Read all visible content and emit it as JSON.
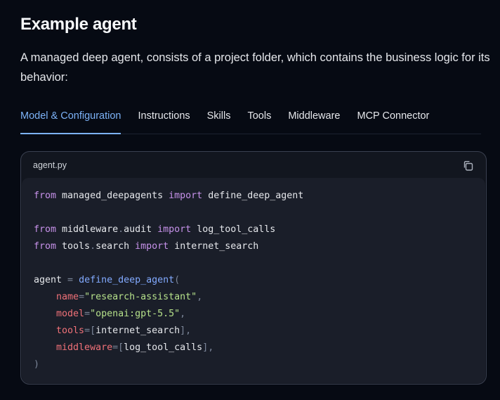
{
  "page": {
    "title": "Example agent",
    "intro": "A managed deep agent, consists of a project folder, which contains the business logic for its behavior:"
  },
  "tabs": [
    {
      "label": "Model & Configuration",
      "active": true
    },
    {
      "label": "Instructions",
      "active": false
    },
    {
      "label": "Skills",
      "active": false
    },
    {
      "label": "Tools",
      "active": false
    },
    {
      "label": "Middleware",
      "active": false
    },
    {
      "label": "MCP Connector",
      "active": false
    }
  ],
  "code": {
    "filename": "agent.py",
    "copy_icon": "copy-icon",
    "lines": [
      [
        [
          "kw",
          "from"
        ],
        [
          "txt",
          " managed_deepagents "
        ],
        [
          "kw",
          "import"
        ],
        [
          "txt",
          " define_deep_agent"
        ]
      ],
      [],
      [
        [
          "kw",
          "from"
        ],
        [
          "txt",
          " middleware"
        ],
        [
          "punc",
          "."
        ],
        [
          "txt",
          "audit "
        ],
        [
          "kw",
          "import"
        ],
        [
          "txt",
          " log_tool_calls"
        ]
      ],
      [
        [
          "kw",
          "from"
        ],
        [
          "txt",
          " tools"
        ],
        [
          "punc",
          "."
        ],
        [
          "txt",
          "search "
        ],
        [
          "kw",
          "import"
        ],
        [
          "txt",
          " internet_search"
        ]
      ],
      [],
      [
        [
          "txt",
          "agent "
        ],
        [
          "punc",
          "="
        ],
        [
          "txt",
          " "
        ],
        [
          "fn",
          "define_deep_agent"
        ],
        [
          "punc",
          "("
        ]
      ],
      [
        [
          "txt",
          "    "
        ],
        [
          "param",
          "name"
        ],
        [
          "punc",
          "="
        ],
        [
          "str",
          "\"research-assistant\""
        ],
        [
          "punc",
          ","
        ]
      ],
      [
        [
          "txt",
          "    "
        ],
        [
          "param",
          "model"
        ],
        [
          "punc",
          "="
        ],
        [
          "str",
          "\"openai:gpt-5.5\""
        ],
        [
          "punc",
          ","
        ]
      ],
      [
        [
          "txt",
          "    "
        ],
        [
          "param",
          "tools"
        ],
        [
          "punc",
          "=["
        ],
        [
          "txt",
          "internet_search"
        ],
        [
          "punc",
          "],"
        ]
      ],
      [
        [
          "txt",
          "    "
        ],
        [
          "param",
          "middleware"
        ],
        [
          "punc",
          "=["
        ],
        [
          "txt",
          "log_tool_calls"
        ],
        [
          "punc",
          "],"
        ]
      ],
      [
        [
          "punc",
          ")"
        ]
      ]
    ]
  },
  "colors": {
    "accent": "#7cb2f7",
    "background": "#060a13",
    "keyword": "#c792ea",
    "function": "#82aaff",
    "string": "#b5e08a",
    "parameter": "#f07178"
  }
}
